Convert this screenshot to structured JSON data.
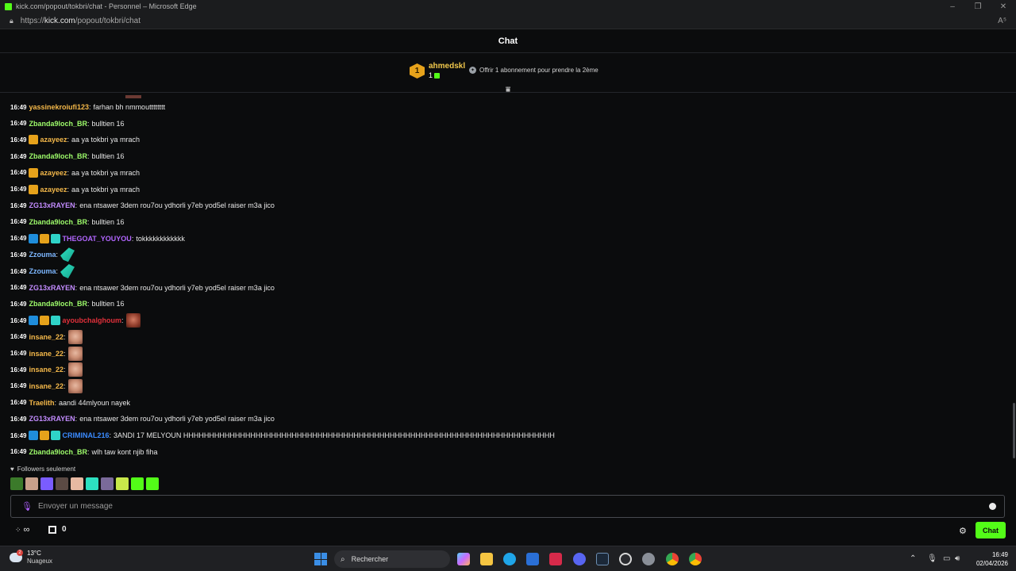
{
  "browser": {
    "title": "kick.com/popout/tokbri/chat - Personnel – Microsoft Edge",
    "url_prefix": "https://",
    "url_domain": "kick.com",
    "url_path": "/popout/tokbri/chat",
    "read_aloud": "A⁵"
  },
  "header": {
    "title": "Chat"
  },
  "pinned": {
    "rank": "1",
    "gifter": "ahmedskl",
    "gift_count": "1",
    "offer": "Offrir 1 abonnement pour prendre la 2ème"
  },
  "messages": [
    {
      "time": "16:49",
      "user": "yassinekroiufi123",
      "color": "#f5b94a",
      "badges": [],
      "text": "farhan bh nmmoutttttttt",
      "emotes": []
    },
    {
      "time": "16:49",
      "user": "Zbanda9loch_BR",
      "color": "#9efc6b",
      "badges": [],
      "text": "bulltien 16",
      "emotes": []
    },
    {
      "time": "16:49",
      "user": "azayeez",
      "color": "#f5b94a",
      "badges": [
        "crown"
      ],
      "text": "aa ya tokbri ya mrach",
      "emotes": []
    },
    {
      "time": "16:49",
      "user": "Zbanda9loch_BR",
      "color": "#9efc6b",
      "badges": [],
      "text": "bulltien 16",
      "emotes": []
    },
    {
      "time": "16:49",
      "user": "azayeez",
      "color": "#f5b94a",
      "badges": [
        "crown"
      ],
      "text": "aa ya tokbri ya mrach",
      "emotes": []
    },
    {
      "time": "16:49",
      "user": "azayeez",
      "color": "#f5b94a",
      "badges": [
        "crown"
      ],
      "text": "aa ya tokbri ya mrach",
      "emotes": []
    },
    {
      "time": "16:49",
      "user": "ZG13xRAYEN",
      "color": "#c38cff",
      "badges": [],
      "text": "ena ntsawer 3dem rou7ou ydhorli y7eb yod5el raiser m3a jico",
      "emotes": []
    },
    {
      "time": "16:49",
      "user": "Zbanda9loch_BR",
      "color": "#9efc6b",
      "badges": [],
      "text": "bulltien 16",
      "emotes": []
    },
    {
      "time": "16:49",
      "user": "THEGOAT_YOUYOU",
      "color": "#b266ff",
      "badges": [
        "mod",
        "crown",
        "vip"
      ],
      "text": "tokkkkkkkkkkkk",
      "emotes": []
    },
    {
      "time": "16:49",
      "user": "Zzouma",
      "color": "#7db7ff",
      "badges": [],
      "text": "",
      "emotes": [
        "fish"
      ]
    },
    {
      "time": "16:49",
      "user": "Zzouma",
      "color": "#7db7ff",
      "badges": [],
      "text": "",
      "emotes": [
        "fish"
      ]
    },
    {
      "time": "16:49",
      "user": "ZG13xRAYEN",
      "color": "#c38cff",
      "badges": [],
      "text": "ena ntsawer 3dem rou7ou ydhorli y7eb yod5el raiser m3a jico",
      "emotes": []
    },
    {
      "time": "16:49",
      "user": "Zbanda9loch_BR",
      "color": "#9efc6b",
      "badges": [],
      "text": "bulltien 16",
      "emotes": []
    },
    {
      "time": "16:49",
      "user": "ayoubchalghoum",
      "color": "#e0303a",
      "badges": [
        "mod",
        "crown",
        "vip"
      ],
      "text": "",
      "emotes": [
        "face-red"
      ]
    },
    {
      "time": "16:49",
      "user": "insane_22",
      "color": "#f5b94a",
      "badges": [],
      "text": "",
      "emotes": [
        "face"
      ]
    },
    {
      "time": "16:49",
      "user": "insane_22",
      "color": "#f5b94a",
      "badges": [],
      "text": "",
      "emotes": [
        "face"
      ]
    },
    {
      "time": "16:49",
      "user": "insane_22",
      "color": "#f5b94a",
      "badges": [],
      "text": "",
      "emotes": [
        "face"
      ]
    },
    {
      "time": "16:49",
      "user": "insane_22",
      "color": "#f5b94a",
      "badges": [],
      "text": "",
      "emotes": [
        "face"
      ]
    },
    {
      "time": "16:49",
      "user": "Traelith",
      "color": "#f5b94a",
      "badges": [],
      "text": "aandi 44mlyoun nayek",
      "emotes": []
    },
    {
      "time": "16:49",
      "user": "ZG13xRAYEN",
      "color": "#c38cff",
      "badges": [],
      "text": "ena ntsawer 3dem rou7ou ydhorli y7eb yod5el raiser m3a jico",
      "emotes": []
    },
    {
      "time": "16:49",
      "user": "CRIMINAL216",
      "color": "#3b8bff",
      "badges": [
        "mod",
        "crown",
        "vip"
      ],
      "text": "3ANDI 17 MELYOUN HHHHHHHHHHHHHHHHHHHHHHHHHHHHHHHHHHHHHHHHHHHHHHHHHHHHHHHHHHHHHHHHHHHHHHHH",
      "emotes": []
    },
    {
      "time": "16:49",
      "user": "Zbanda9loch_BR",
      "color": "#9efc6b",
      "badges": [],
      "text": "wlh taw kont njib fiha",
      "emotes": []
    }
  ],
  "followers_mode": "Followers seulement",
  "emote_bar": [
    "#3b7a2a",
    "#c9a08a",
    "#7a5cff",
    "#5b4a44",
    "#e7b9a2",
    "#2de0c0",
    "#7a6a9a",
    "#c8e84a",
    "#53fc18",
    "#53fc18"
  ],
  "input": {
    "placeholder": "Envoyer un message"
  },
  "controls": {
    "points": "∞",
    "gift_count": "0",
    "send_label": "Chat"
  },
  "taskbar": {
    "temperature": "13°C",
    "condition": "Nuageux",
    "weather_badge": "2",
    "search_label": "Rechercher",
    "time": "16:49",
    "date": "02/04/2026"
  }
}
